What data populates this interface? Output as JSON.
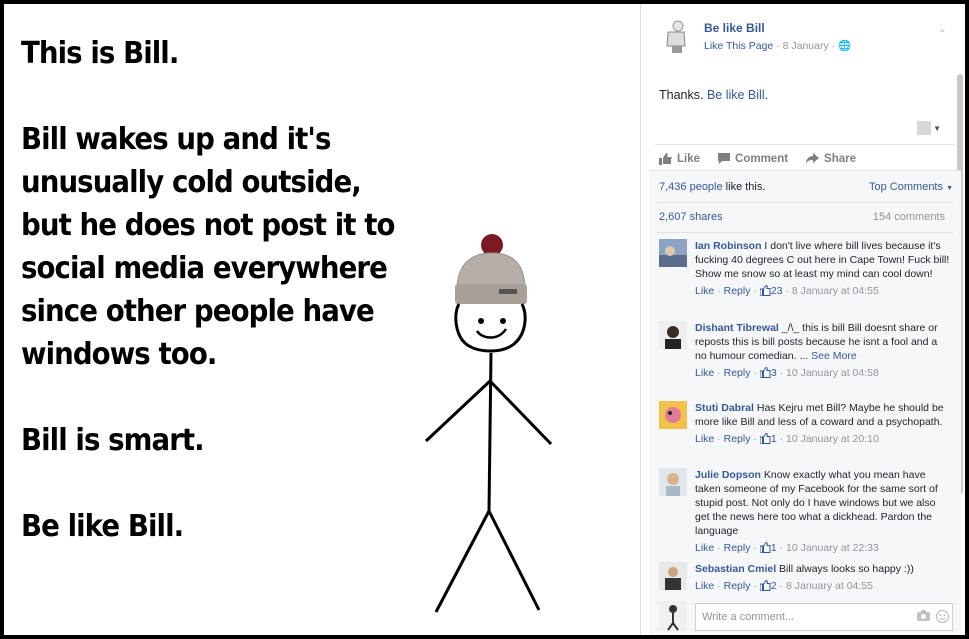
{
  "meme": {
    "lines": [
      "This is Bill.",
      "Bill wakes up and it's",
      "unusually cold outside,",
      "but he does not post it to",
      "social media everywhere",
      "since other people have",
      "windows too.",
      "Bill is smart.",
      "Be like Bill."
    ]
  },
  "post": {
    "page_name": "Be like Bill",
    "like_page": "Like This Page",
    "date": " · 8 January · ",
    "text_prefix": "Thanks. ",
    "text_link": "Be like Bill",
    "text_suffix": "."
  },
  "actions": {
    "like": "Like",
    "comment": "Comment",
    "share": "Share"
  },
  "stats": {
    "people": "7,436 people",
    "like_this": " like this.",
    "top_comments": "Top Comments",
    "shares": "2,607 shares",
    "comments": "154 comments"
  },
  "comments": [
    {
      "name": "Ian Robinson",
      "text": " I don't live where bill lives because it's fucking 40 degrees C out here in Cape Town! Fuck bill! Show me snow so at least my mind can cool down!",
      "see_more": "",
      "likes": "23",
      "time": "8 January at 04:55"
    },
    {
      "name": "Dishant Tibrewal",
      "text": " _/\\_ this is bill Bill doesnt share or reposts this is bill posts because he isnt a fool and a no humour comedian. ...",
      "see_more": " See More",
      "likes": "3",
      "time": "10 January at 04:58"
    },
    {
      "name": "Stuti Dabral",
      "text": " Has Kejru met Bill? Maybe he should be more like Bill and less of a coward and a psychopath.",
      "see_more": "",
      "likes": "1",
      "time": "10 January at 20:10"
    },
    {
      "name": "Julie Dopson",
      "text": " Know exactly what you mean have taken someone of my Facebook for the same sort of stupid post. Not only do I have windows but we also get the news here too what a dickhead. Pardon the language",
      "see_more": "",
      "likes": "1",
      "time": "10 January at 22:33"
    },
    {
      "name": "Sebastian Cmiel",
      "text": " Bill always looks so happy :))",
      "see_more": "",
      "likes": "2",
      "time": "8 January at 04:55"
    }
  ],
  "comment_meta": {
    "like": "Like",
    "reply": "Reply",
    "dot": " · "
  },
  "composer": {
    "placeholder": "Write a comment..."
  },
  "colors": {
    "link": "#365899",
    "muted": "#90949c",
    "ufi_bg": "#f6f7f9"
  }
}
